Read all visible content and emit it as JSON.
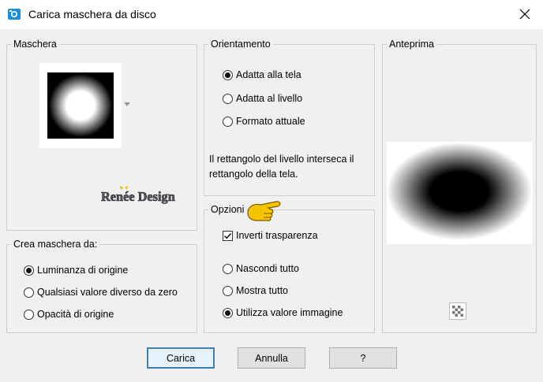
{
  "window": {
    "title": "Carica maschera da disco"
  },
  "maschera": {
    "label": "Maschera",
    "watermark": "Renée Design"
  },
  "orientamento": {
    "label": "Orientamento",
    "options": [
      "Adatta alla tela",
      "Adatta al livello",
      "Formato attuale"
    ],
    "selected": 0,
    "info": [
      "Il rettangolo del livello interseca il",
      "rettangolo della tela."
    ]
  },
  "anteprima": {
    "label": "Anteprima"
  },
  "crea": {
    "label": "Crea maschera da:",
    "options": [
      "Luminanza di origine",
      "Qualsiasi valore diverso da zero",
      "Opacità di origine"
    ],
    "selected": 0
  },
  "opzioni": {
    "label": "Opzioni",
    "invert_label": "Inverti trasparenza",
    "invert_checked": true,
    "options": [
      "Nascondi tutto",
      "Mostra tutto",
      "Utilizza valore immagine"
    ],
    "selected": 2
  },
  "buttons": {
    "load": "Carica",
    "cancel": "Annulla",
    "help": "?"
  },
  "colors": {
    "accent": "#3c7fb1",
    "title_icon": "#1e8fd6",
    "hand": "#f5c400"
  }
}
